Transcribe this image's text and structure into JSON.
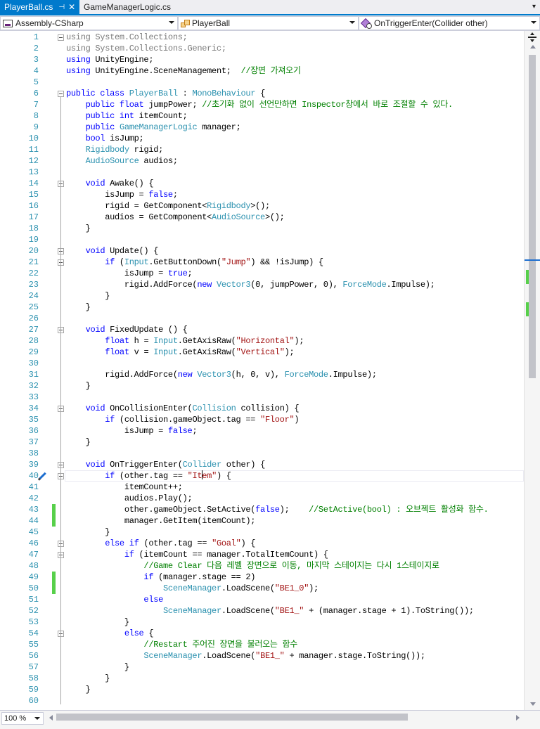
{
  "tabs": [
    {
      "label": "PlayerBall.cs",
      "active": true
    },
    {
      "label": "GameManagerLogic.cs",
      "active": false
    }
  ],
  "tab_icons": {
    "pin": "pin-icon",
    "close": "close-icon",
    "overflow": "dropdown-overflow-icon"
  },
  "navbar": {
    "project": "Assembly-CSharp",
    "type": "PlayerBall",
    "member": "OnTriggerEnter(Collider other)"
  },
  "zoom": "100 %",
  "colors": {
    "accent": "#007acc",
    "keyword": "#0000ff",
    "type": "#2b91af",
    "string": "#a31515",
    "comment": "#008000",
    "change_bar": "#57d04a",
    "line_number": "#2b91af"
  },
  "editor": {
    "current_line": 40,
    "lines": [
      {
        "n": "1",
        "tokens": [
          [
            "dim",
            "using System.Collections;"
          ]
        ]
      },
      {
        "n": "2",
        "tokens": [
          [
            "dim",
            "using System.Collections.Generic;"
          ]
        ]
      },
      {
        "n": "3",
        "tokens": [
          [
            "kw",
            "using"
          ],
          [
            "pl",
            " UnityEngine;"
          ]
        ]
      },
      {
        "n": "4",
        "tokens": [
          [
            "kw",
            "using"
          ],
          [
            "pl",
            " UnityEngine.SceneManagement;  "
          ],
          [
            "com",
            "//장면 가져오기"
          ]
        ]
      },
      {
        "n": "5",
        "tokens": []
      },
      {
        "n": "6",
        "tokens": [
          [
            "kw",
            "public class"
          ],
          [
            "pl",
            " "
          ],
          [
            "ty",
            "PlayerBall"
          ],
          [
            "pl",
            " : "
          ],
          [
            "ty",
            "MonoBehaviour"
          ],
          [
            "pl",
            " {"
          ]
        ]
      },
      {
        "n": "7",
        "tokens": [
          [
            "pl",
            "    "
          ],
          [
            "kw",
            "public float"
          ],
          [
            "pl",
            " jumpPower; "
          ],
          [
            "com",
            "//초기화 없이 선언만하면 Inspector창에서 바로 조절할 수 있다."
          ]
        ]
      },
      {
        "n": "8",
        "tokens": [
          [
            "pl",
            "    "
          ],
          [
            "kw",
            "public int"
          ],
          [
            "pl",
            " itemCount;"
          ]
        ]
      },
      {
        "n": "9",
        "tokens": [
          [
            "pl",
            "    "
          ],
          [
            "kw",
            "public"
          ],
          [
            "pl",
            " "
          ],
          [
            "ty",
            "GameManagerLogic"
          ],
          [
            "pl",
            " manager;"
          ]
        ]
      },
      {
        "n": "10",
        "tokens": [
          [
            "pl",
            "    "
          ],
          [
            "kw",
            "bool"
          ],
          [
            "pl",
            " isJump;"
          ]
        ]
      },
      {
        "n": "11",
        "tokens": [
          [
            "pl",
            "    "
          ],
          [
            "ty",
            "Rigidbody"
          ],
          [
            "pl",
            " rigid;"
          ]
        ]
      },
      {
        "n": "12",
        "tokens": [
          [
            "pl",
            "    "
          ],
          [
            "ty",
            "AudioSource"
          ],
          [
            "pl",
            " audios;"
          ]
        ]
      },
      {
        "n": "13",
        "tokens": []
      },
      {
        "n": "14",
        "tokens": [
          [
            "pl",
            "    "
          ],
          [
            "kw",
            "void"
          ],
          [
            "pl",
            " Awake() {"
          ]
        ]
      },
      {
        "n": "15",
        "tokens": [
          [
            "pl",
            "        isJump = "
          ],
          [
            "kw",
            "false"
          ],
          [
            "pl",
            ";"
          ]
        ]
      },
      {
        "n": "16",
        "tokens": [
          [
            "pl",
            "        rigid = GetComponent<"
          ],
          [
            "ty",
            "Rigidbody"
          ],
          [
            "pl",
            ">();"
          ]
        ]
      },
      {
        "n": "17",
        "tokens": [
          [
            "pl",
            "        audios = GetComponent<"
          ],
          [
            "ty",
            "AudioSource"
          ],
          [
            "pl",
            ">();"
          ]
        ]
      },
      {
        "n": "18",
        "tokens": [
          [
            "pl",
            "    }"
          ]
        ]
      },
      {
        "n": "19",
        "tokens": []
      },
      {
        "n": "20",
        "tokens": [
          [
            "pl",
            "    "
          ],
          [
            "kw",
            "void"
          ],
          [
            "pl",
            " Update() {"
          ]
        ]
      },
      {
        "n": "21",
        "tokens": [
          [
            "pl",
            "        "
          ],
          [
            "kw",
            "if"
          ],
          [
            "pl",
            " ("
          ],
          [
            "ty",
            "Input"
          ],
          [
            "pl",
            ".GetButtonDown("
          ],
          [
            "str",
            "\"Jump\""
          ],
          [
            "pl",
            ") && !isJump) {"
          ]
        ]
      },
      {
        "n": "22",
        "tokens": [
          [
            "pl",
            "            isJump = "
          ],
          [
            "kw",
            "true"
          ],
          [
            "pl",
            ";"
          ]
        ]
      },
      {
        "n": "23",
        "tokens": [
          [
            "pl",
            "            rigid.AddForce("
          ],
          [
            "kw",
            "new"
          ],
          [
            "pl",
            " "
          ],
          [
            "ty",
            "Vector3"
          ],
          [
            "pl",
            "(0, jumpPower, 0), "
          ],
          [
            "ty",
            "ForceMode"
          ],
          [
            "pl",
            ".Impulse);"
          ]
        ]
      },
      {
        "n": "24",
        "tokens": [
          [
            "pl",
            "        }"
          ]
        ]
      },
      {
        "n": "25",
        "tokens": [
          [
            "pl",
            "    }"
          ]
        ]
      },
      {
        "n": "26",
        "tokens": []
      },
      {
        "n": "27",
        "tokens": [
          [
            "pl",
            "    "
          ],
          [
            "kw",
            "void"
          ],
          [
            "pl",
            " FixedUpdate () {"
          ]
        ]
      },
      {
        "n": "28",
        "tokens": [
          [
            "pl",
            "        "
          ],
          [
            "kw",
            "float"
          ],
          [
            "pl",
            " h = "
          ],
          [
            "ty",
            "Input"
          ],
          [
            "pl",
            ".GetAxisRaw("
          ],
          [
            "str",
            "\"Horizontal\""
          ],
          [
            "pl",
            ");"
          ]
        ]
      },
      {
        "n": "29",
        "tokens": [
          [
            "pl",
            "        "
          ],
          [
            "kw",
            "float"
          ],
          [
            "pl",
            " v = "
          ],
          [
            "ty",
            "Input"
          ],
          [
            "pl",
            ".GetAxisRaw("
          ],
          [
            "str",
            "\"Vertical\""
          ],
          [
            "pl",
            ");"
          ]
        ]
      },
      {
        "n": "30",
        "tokens": []
      },
      {
        "n": "31",
        "tokens": [
          [
            "pl",
            "        rigid.AddForce("
          ],
          [
            "kw",
            "new"
          ],
          [
            "pl",
            " "
          ],
          [
            "ty",
            "Vector3"
          ],
          [
            "pl",
            "(h, 0, v), "
          ],
          [
            "ty",
            "ForceMode"
          ],
          [
            "pl",
            ".Impulse);"
          ]
        ]
      },
      {
        "n": "32",
        "tokens": [
          [
            "pl",
            "    }"
          ]
        ]
      },
      {
        "n": "33",
        "tokens": []
      },
      {
        "n": "34",
        "tokens": [
          [
            "pl",
            "    "
          ],
          [
            "kw",
            "void"
          ],
          [
            "pl",
            " OnCollisionEnter("
          ],
          [
            "ty",
            "Collision"
          ],
          [
            "pl",
            " collision) {"
          ]
        ]
      },
      {
        "n": "35",
        "tokens": [
          [
            "pl",
            "        "
          ],
          [
            "kw",
            "if"
          ],
          [
            "pl",
            " (collision.gameObject.tag == "
          ],
          [
            "str",
            "\"Floor\""
          ],
          [
            "pl",
            ")"
          ]
        ]
      },
      {
        "n": "36",
        "tokens": [
          [
            "pl",
            "            isJump = "
          ],
          [
            "kw",
            "false"
          ],
          [
            "pl",
            ";"
          ]
        ]
      },
      {
        "n": "37",
        "tokens": [
          [
            "pl",
            "    }"
          ]
        ]
      },
      {
        "n": "38",
        "tokens": []
      },
      {
        "n": "39",
        "tokens": [
          [
            "pl",
            "    "
          ],
          [
            "kw",
            "void"
          ],
          [
            "pl",
            " OnTriggerEnter("
          ],
          [
            "ty",
            "Collider"
          ],
          [
            "pl",
            " other) {"
          ]
        ]
      },
      {
        "n": "40",
        "tokens": [
          [
            "pl",
            "        "
          ],
          [
            "kw",
            "if"
          ],
          [
            "pl",
            " (other.tag == "
          ],
          [
            "str",
            "\"It"
          ],
          [
            "caret",
            ""
          ],
          [
            "str",
            "em\""
          ],
          [
            "pl",
            ") {"
          ]
        ]
      },
      {
        "n": "41",
        "tokens": [
          [
            "pl",
            "            itemCount++;"
          ]
        ]
      },
      {
        "n": "42",
        "tokens": [
          [
            "pl",
            "            audios.Play();"
          ]
        ]
      },
      {
        "n": "43",
        "tokens": [
          [
            "pl",
            "            other.gameObject.SetActive("
          ],
          [
            "kw",
            "false"
          ],
          [
            "pl",
            ");    "
          ],
          [
            "com",
            "//SetActive(bool) : 오브젝트 활성화 함수."
          ]
        ]
      },
      {
        "n": "44",
        "tokens": [
          [
            "pl",
            "            manager.GetItem(itemCount);"
          ]
        ]
      },
      {
        "n": "45",
        "tokens": [
          [
            "pl",
            "        }"
          ]
        ]
      },
      {
        "n": "46",
        "tokens": [
          [
            "pl",
            "        "
          ],
          [
            "kw",
            "else if"
          ],
          [
            "pl",
            " (other.tag == "
          ],
          [
            "str",
            "\"Goal\""
          ],
          [
            "pl",
            ") {"
          ]
        ]
      },
      {
        "n": "47",
        "tokens": [
          [
            "pl",
            "            "
          ],
          [
            "kw",
            "if"
          ],
          [
            "pl",
            " (itemCount == manager.TotalItemCount) {"
          ]
        ]
      },
      {
        "n": "48",
        "tokens": [
          [
            "pl",
            "                "
          ],
          [
            "com",
            "//Game Clear 다음 레벨 장면으로 이동, 마지막 스테이지는 다시 1스테이지로"
          ]
        ]
      },
      {
        "n": "49",
        "tokens": [
          [
            "pl",
            "                "
          ],
          [
            "kw",
            "if"
          ],
          [
            "pl",
            " (manager.stage == 2)"
          ]
        ]
      },
      {
        "n": "50",
        "tokens": [
          [
            "pl",
            "                    "
          ],
          [
            "ty",
            "SceneManager"
          ],
          [
            "pl",
            ".LoadScene("
          ],
          [
            "str",
            "\"BE1_0\""
          ],
          [
            "pl",
            ");"
          ]
        ]
      },
      {
        "n": "51",
        "tokens": [
          [
            "pl",
            "                "
          ],
          [
            "kw",
            "else"
          ]
        ]
      },
      {
        "n": "52",
        "tokens": [
          [
            "pl",
            "                    "
          ],
          [
            "ty",
            "SceneManager"
          ],
          [
            "pl",
            ".LoadScene("
          ],
          [
            "str",
            "\"BE1_\""
          ],
          [
            "pl",
            " + (manager.stage + 1).ToString());"
          ]
        ]
      },
      {
        "n": "53",
        "tokens": [
          [
            "pl",
            "            }"
          ]
        ]
      },
      {
        "n": "54",
        "tokens": [
          [
            "pl",
            "            "
          ],
          [
            "kw",
            "else"
          ],
          [
            "pl",
            " {"
          ]
        ]
      },
      {
        "n": "55",
        "tokens": [
          [
            "pl",
            "                "
          ],
          [
            "com",
            "//Restart 주어진 장면을 불러오는 함수"
          ]
        ]
      },
      {
        "n": "56",
        "tokens": [
          [
            "pl",
            "                "
          ],
          [
            "ty",
            "SceneManager"
          ],
          [
            "pl",
            ".LoadScene("
          ],
          [
            "str",
            "\"BE1_\""
          ],
          [
            "pl",
            " + manager.stage.ToString());"
          ]
        ]
      },
      {
        "n": "57",
        "tokens": [
          [
            "pl",
            "            }"
          ]
        ]
      },
      {
        "n": "58",
        "tokens": [
          [
            "pl",
            "        }"
          ]
        ]
      },
      {
        "n": "59",
        "tokens": [
          [
            "pl",
            "    }"
          ]
        ]
      },
      {
        "n": "60",
        "tokens": []
      }
    ],
    "fold_lines": [
      1,
      6,
      14,
      20,
      21,
      27,
      34,
      39,
      40,
      46,
      47,
      54
    ],
    "changed_lines": [
      43,
      44,
      49,
      50
    ],
    "glyph_line": 40,
    "glyph_icon": "quick-action-pencil-icon"
  }
}
